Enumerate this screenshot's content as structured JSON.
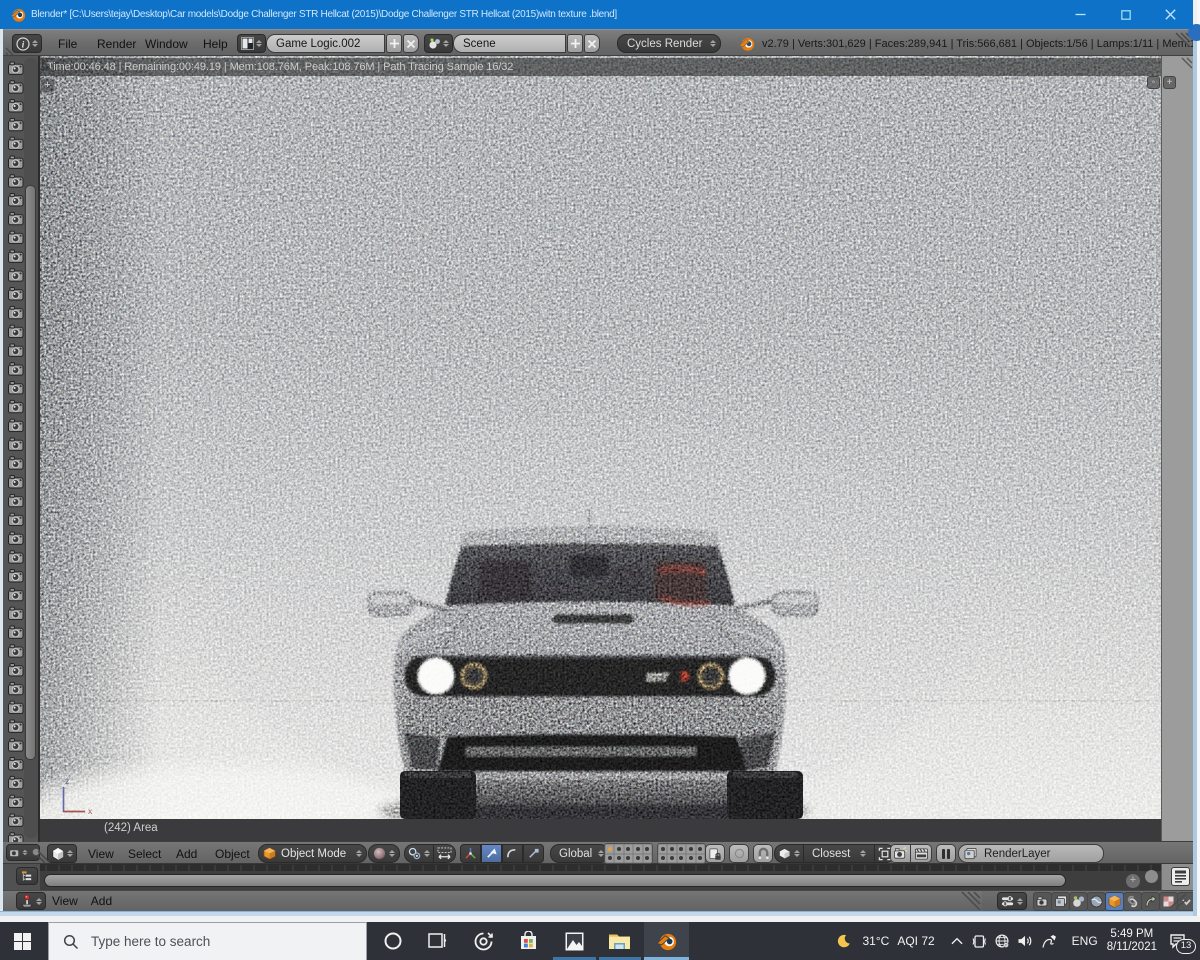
{
  "window": {
    "title": "Blender* [C:\\Users\\tejay\\Desktop\\Car models\\Dodge Challenger STR Hellcat (2015)\\Dodge Challenger STR Hellcat (2015)witn texture .blend]",
    "controls": {
      "minimize": "minimize",
      "maximize": "maximize",
      "close": "close"
    }
  },
  "header": {
    "menus": [
      {
        "label": "File"
      },
      {
        "label": "Render"
      },
      {
        "label": "Window"
      },
      {
        "label": "Help"
      }
    ],
    "screen_layout": {
      "value": "Game Logic.002",
      "add_label": "+",
      "close_label": "X"
    },
    "scene": {
      "value": "Scene",
      "add_label": "+",
      "close_label": "X"
    },
    "engine": {
      "value": "Cycles Render"
    },
    "stats": "v2.79 | Verts:301,629 | Faces:289,941 | Tris:566,681 | Objects:1/56 | Lamps:1/11 | Mem:1"
  },
  "viewport": {
    "render_status": "Time:00:46.48 | Remaining:00:49.19 | Mem:108.76M, Peak:108.76M | Path Tracing Sample 16/32",
    "area_label": "(242) Area",
    "collapsed_panel_plus": "+",
    "car_badge": "SRT",
    "axis": {
      "x_label": "x",
      "z_label": "z"
    },
    "header": {
      "menus": [
        {
          "label": "View"
        },
        {
          "label": "Select"
        },
        {
          "label": "Add"
        },
        {
          "label": "Object"
        }
      ],
      "mode": "Object Mode",
      "orientation": "Global",
      "snap_mode": "Closest",
      "render_layer": "RenderLayer",
      "layer_columns": 5,
      "layer_rows": 2,
      "layer_blocks": 2
    }
  },
  "left_strip": {
    "icon": "camera-icon",
    "icon_count": 42
  },
  "timeline": {
    "tick_count": 86,
    "zoom_plus": "+"
  },
  "logic_editor": {
    "menus": [
      {
        "label": "View"
      },
      {
        "label": "Add"
      }
    ]
  },
  "properties_editor": {
    "tabs": [
      "render",
      "render-layers",
      "scene",
      "world",
      "object",
      "constraints",
      "modifiers",
      "material",
      "dropdown"
    ],
    "active_tab": "object"
  },
  "taskbar": {
    "search_placeholder": "Type here to search",
    "icons": [
      "start",
      "cortana",
      "task-view",
      "edge-target",
      "store",
      "photos",
      "file-explorer",
      "blender"
    ],
    "tray": {
      "weather_temp": "31°C",
      "aqi": "AQI 72",
      "language": "ENG",
      "time": "5:49 PM",
      "date": "8/11/2021",
      "notification_count": "13"
    }
  },
  "colors": {
    "titlebar": "#0e72c8",
    "accent_orange": "#e8a33d",
    "selected_tab_blue": "#5a7fb8",
    "taskbar": "#2e3137",
    "underline_active": "#7fb2dc",
    "underline_running": "#3f75a4"
  }
}
